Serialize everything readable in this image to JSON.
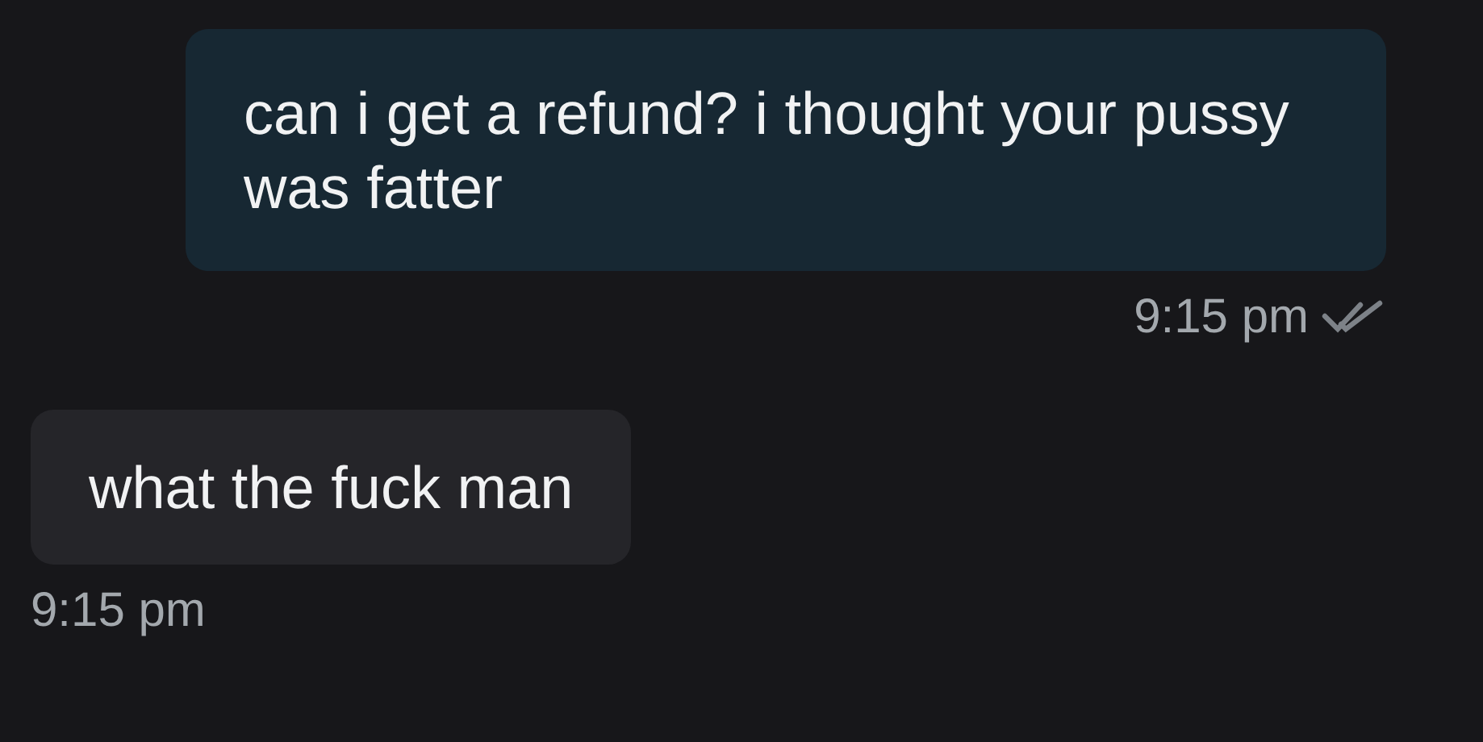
{
  "messages": [
    {
      "kind": "outgoing",
      "text": "can i get a refund? i thought your pussy was fatter",
      "time": "9:15 pm",
      "read": true
    },
    {
      "kind": "incoming",
      "text": "what the fuck man",
      "time": "9:15 pm"
    }
  ]
}
